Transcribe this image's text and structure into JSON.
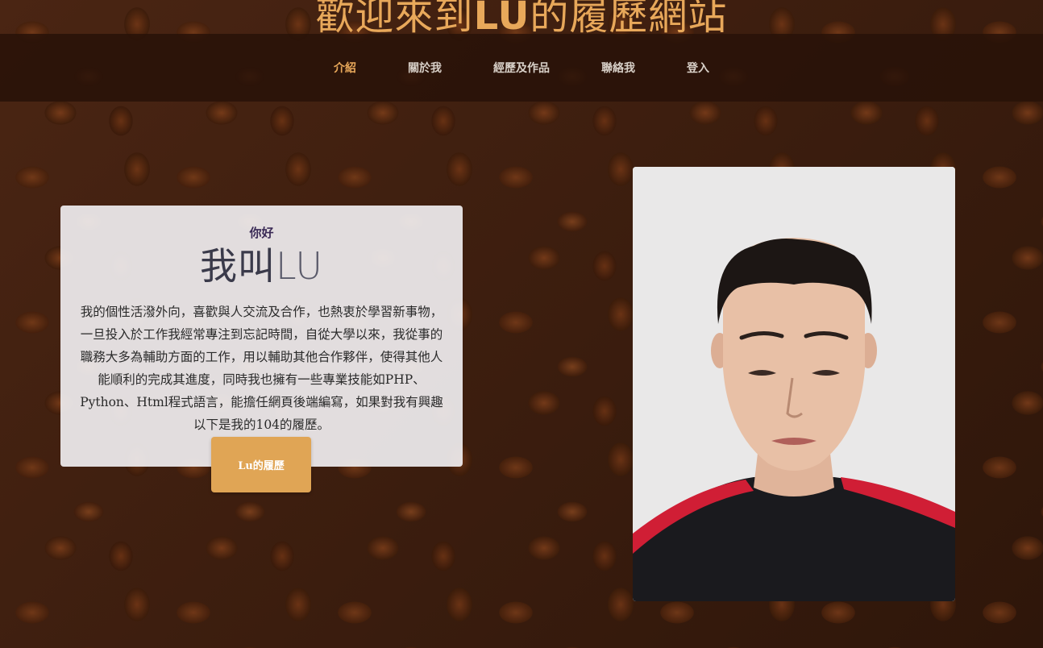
{
  "header": {
    "title_part1": "歡迎來到",
    "title_accent": "LU",
    "title_part2": "的履歷網站"
  },
  "nav": {
    "items": [
      {
        "label": "介紹",
        "active": true
      },
      {
        "label": "關於我",
        "active": false
      },
      {
        "label": "經歷及作品",
        "active": false
      },
      {
        "label": "聯絡我",
        "active": false
      },
      {
        "label": "登入",
        "active": false
      }
    ]
  },
  "intro": {
    "greeting": "你好",
    "name_prefix": "我叫",
    "name": "LU",
    "description": "我的個性活潑外向，喜歡與人交流及合作，也熱衷於學習新事物，一旦投入於工作我經常專注到忘記時間，自從大學以來，我從事的職務大多為輔助方面的工作，用以輔助其他合作夥伴，使得其他人能順利的完成其進度，同時我也擁有一些專業技能如PHP、Python、Html程式語言，能擔任網頁後端編寫，如果對我有興趣以下是我的104的履歷。",
    "button_label": "Lu的履歷"
  },
  "colors": {
    "accent": "#e8a85a",
    "button": "#e0a555",
    "navbar_bg": "#2a1208"
  }
}
